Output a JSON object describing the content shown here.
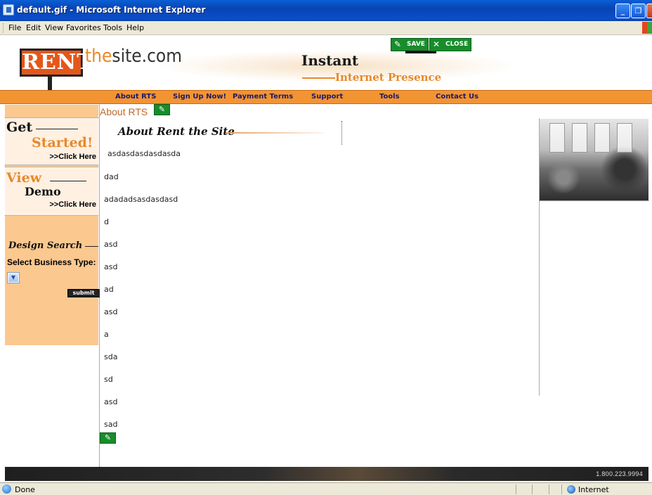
{
  "window": {
    "title": "default.gif - Microsoft Internet Explorer",
    "minimize_symbol": "_",
    "restore_symbol": "❐"
  },
  "menubar": {
    "items": [
      "File",
      "Edit",
      "View",
      "Favorites",
      "Tools",
      "Help"
    ]
  },
  "header": {
    "logo_rent": "RENT",
    "logo_the": "the",
    "logo_rest": "site.com",
    "tagline_1": "Instant",
    "tagline_2": "Internet Presence",
    "save_label": "SAVE",
    "close_label": "CLOSE",
    "save_icon": "save-icon",
    "close_icon": "close-icon"
  },
  "nav": {
    "items": [
      "About RTS",
      "Sign Up Now!",
      "Payment Terms",
      "Support",
      "Tools",
      "Contact Us"
    ]
  },
  "sidebar": {
    "get_big_1": "Get",
    "get_big_2": "Started!",
    "get_click": ">>Click Here",
    "view_big_1": "View",
    "view_big_2": "Demo",
    "view_click": ">>Click Here",
    "design_title": "Design Search",
    "select_label": "Select Business Type:",
    "submit_label": "submit"
  },
  "main": {
    "heading": "About RTS",
    "section_title": "About Rent the Site",
    "lines": [
      "asdasdasdasdasda",
      "dad",
      "adadadsasdasdasd",
      "d",
      "asd",
      "asd",
      "ad",
      "asd",
      "a",
      "sda",
      "sd",
      "asd",
      "sad"
    ]
  },
  "footer": {
    "phone": "1.800.223.9994"
  },
  "statusbar": {
    "status": "Done",
    "zone": "Internet"
  },
  "colors": {
    "accent_orange": "#f39433",
    "sidebar_peach": "#fbc88f",
    "edit_green": "#178d2b",
    "link_navy": "#1a1a6b"
  }
}
